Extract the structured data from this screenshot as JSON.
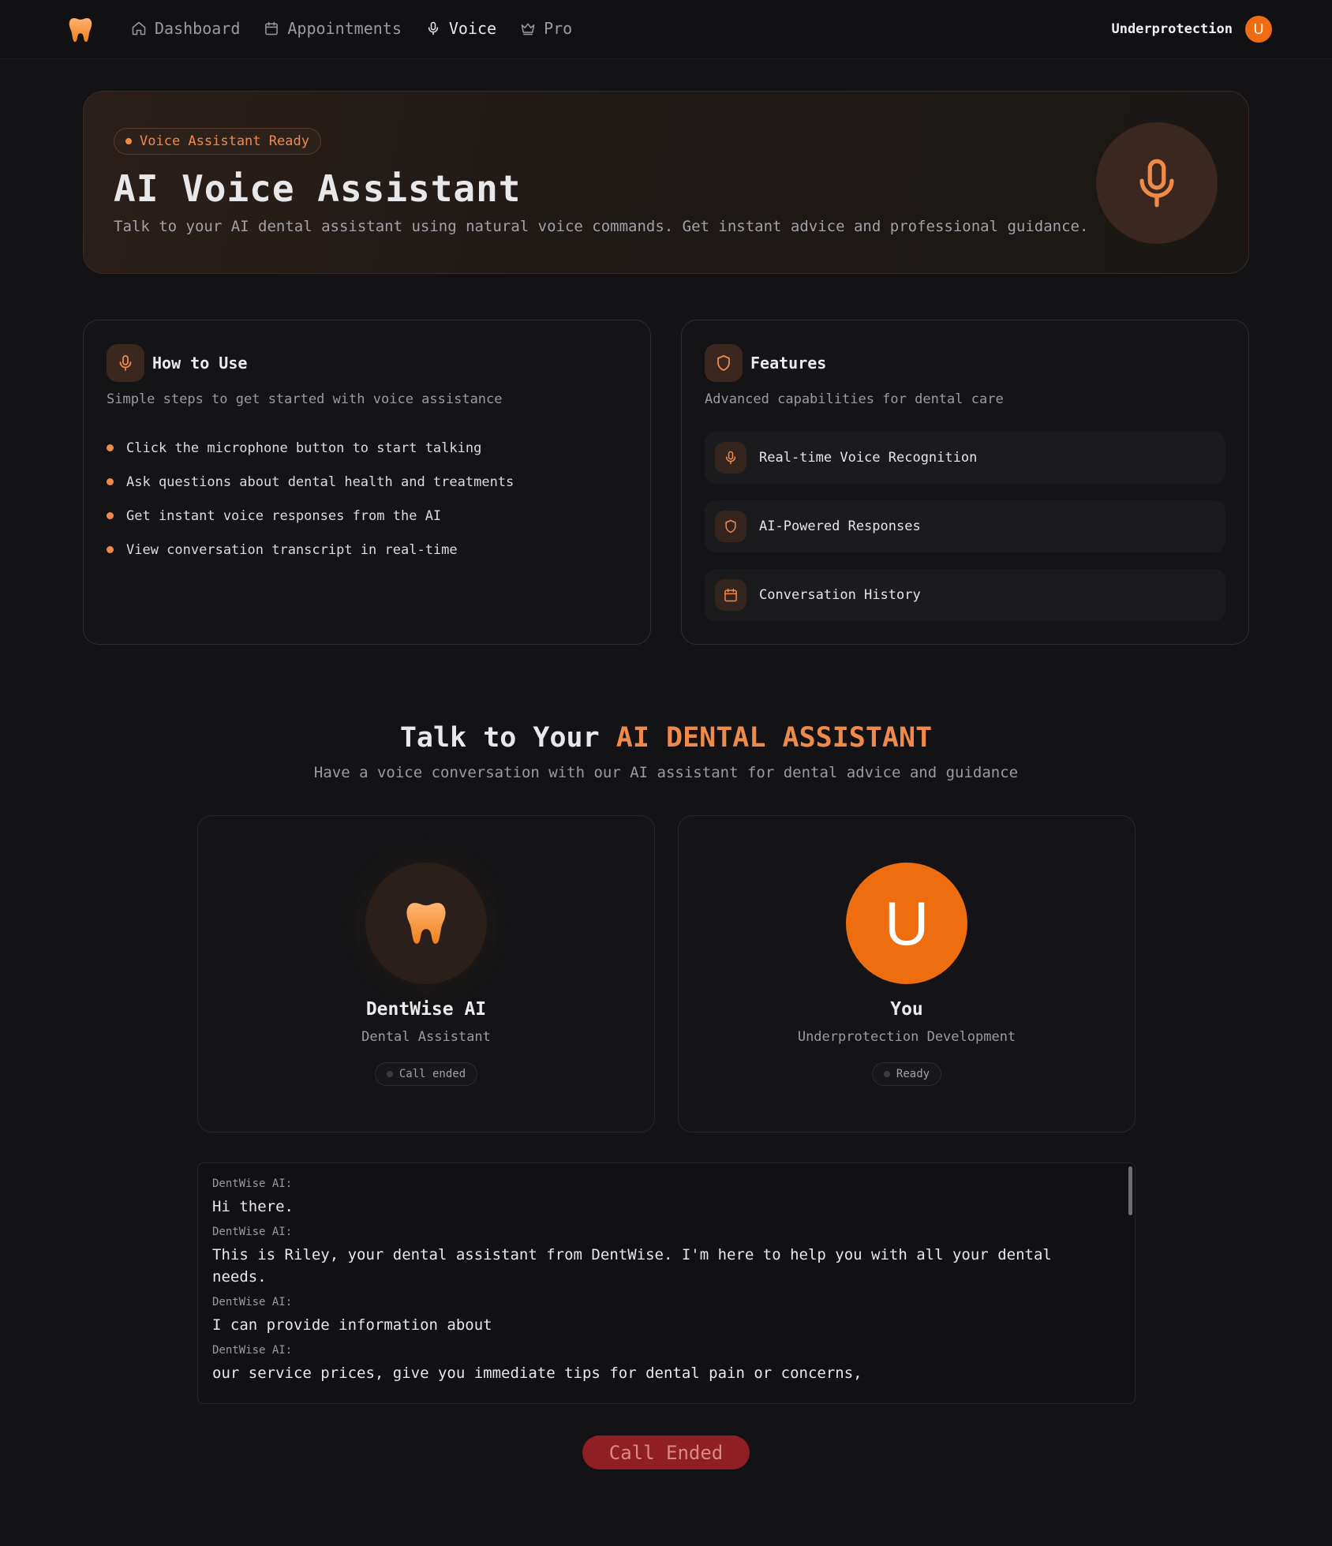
{
  "nav": {
    "links": [
      {
        "label": "Dashboard",
        "icon": "home-icon"
      },
      {
        "label": "Appointments",
        "icon": "calendar-icon"
      },
      {
        "label": "Voice",
        "icon": "mic-icon",
        "active": true
      },
      {
        "label": "Pro",
        "icon": "crown-icon"
      }
    ],
    "user_name": "Underprotection",
    "avatar_letter": "U"
  },
  "hero": {
    "badge": "Voice Assistant Ready",
    "title": "AI Voice Assistant",
    "subtitle": "Talk to your AI dental assistant using natural voice commands. Get instant advice and professional guidance."
  },
  "how_to": {
    "title": "How to Use",
    "description": "Simple steps to get started with voice assistance",
    "steps": [
      "Click the microphone button to start talking",
      "Ask questions about dental health and treatments",
      "Get instant voice responses from the AI",
      "View conversation transcript in real-time"
    ]
  },
  "features": {
    "title": "Features",
    "description": "Advanced capabilities for dental care",
    "items": [
      {
        "label": "Real-time Voice Recognition",
        "icon": "mic-icon"
      },
      {
        "label": "AI-Powered Responses",
        "icon": "shield-icon"
      },
      {
        "label": "Conversation History",
        "icon": "calendar-icon"
      }
    ]
  },
  "talk": {
    "title_prefix": "Talk to Your ",
    "title_highlight": "AI DENTAL ASSISTANT",
    "subtitle": "Have a voice conversation with our AI assistant for dental advice and guidance"
  },
  "assistant": {
    "name": "DentWise AI",
    "role": "Dental Assistant",
    "status": "Call ended"
  },
  "user": {
    "name": "You",
    "role": "Underprotection Development",
    "status": "Ready",
    "avatar_letter": "U"
  },
  "transcript": [
    {
      "speaker": "DentWise AI:",
      "text": "Hi there."
    },
    {
      "speaker": "DentWise AI:",
      "text": "This is Riley, your dental assistant from DentWise. I'm here to help you with all your dental needs."
    },
    {
      "speaker": "DentWise AI:",
      "text": "I can provide information about"
    },
    {
      "speaker": "DentWise AI:",
      "text": "our service prices, give you immediate tips for dental pain or concerns,"
    }
  ],
  "call_button": "Call Ended",
  "colors": {
    "accent": "#f08a4b",
    "avatar": "#ef6c12",
    "end_button": "#8f1f24",
    "background": "#131315"
  }
}
